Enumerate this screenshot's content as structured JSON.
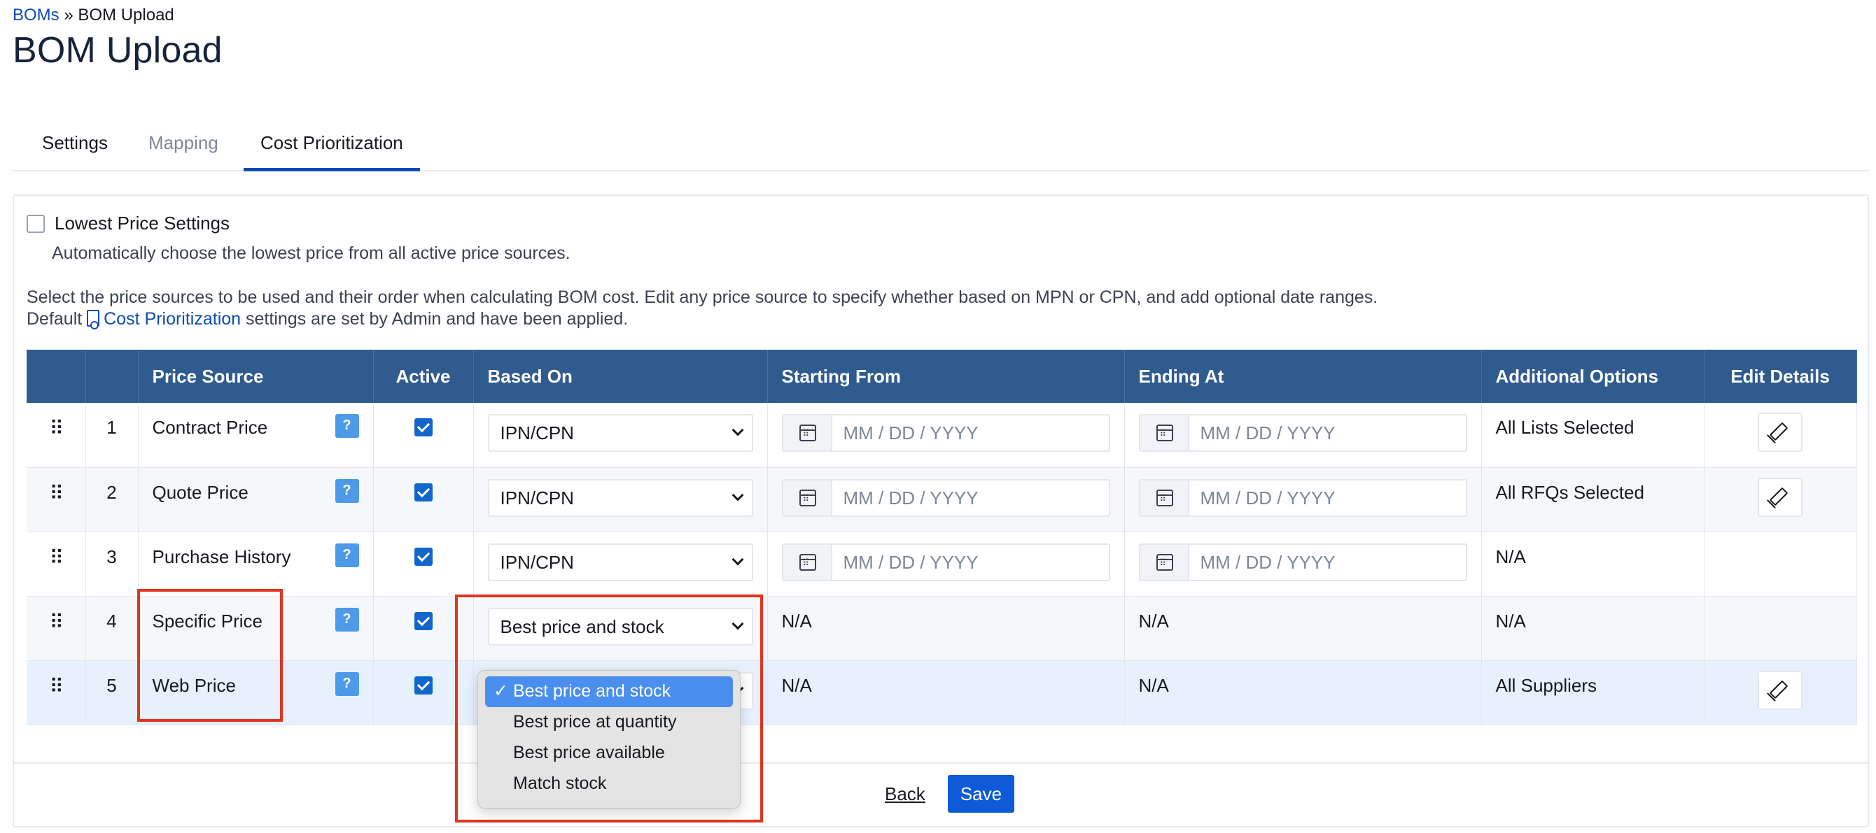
{
  "breadcrumb": {
    "parent": "BOMs",
    "separator": "»",
    "current": "BOM Upload"
  },
  "page_title": "BOM Upload",
  "tabs": [
    {
      "label": "Settings",
      "state": "default"
    },
    {
      "label": "Mapping",
      "state": "disabled"
    },
    {
      "label": "Cost Prioritization",
      "state": "active"
    }
  ],
  "lowest_price": {
    "label": "Lowest Price Settings",
    "checked": false,
    "help": "Automatically choose the lowest price from all active price sources."
  },
  "description": {
    "line1": "Select the price sources to be used and their order when calculating BOM cost. Edit any price source to specify whether based on MPN or CPN, and add optional date ranges.",
    "prefix": "Default",
    "link": "Cost Prioritization",
    "suffix": "settings are set by Admin and have been applied."
  },
  "table": {
    "headers": [
      "",
      "",
      "Price Source",
      "Active",
      "Based On",
      "Starting From",
      "Ending At",
      "Additional Options",
      "Edit Details"
    ],
    "date_placeholder": "MM / DD / YYYY",
    "help_badge": "?",
    "rows": [
      {
        "num": "1",
        "source": "Contract Price",
        "based_on": "IPN/CPN",
        "start": "date",
        "end": "date",
        "options": "All Lists Selected",
        "edit": true
      },
      {
        "num": "2",
        "source": "Quote Price",
        "based_on": "IPN/CPN",
        "start": "date",
        "end": "date",
        "options": "All RFQs Selected",
        "edit": true
      },
      {
        "num": "3",
        "source": "Purchase History",
        "based_on": "IPN/CPN",
        "start": "date",
        "end": "date",
        "options": "N/A",
        "edit": false
      },
      {
        "num": "4",
        "source": "Specific Price",
        "based_on": "Best price and stock",
        "start": "N/A",
        "end": "N/A",
        "options": "N/A",
        "edit": false
      },
      {
        "num": "5",
        "source": "Web Price",
        "based_on": "",
        "start": "N/A",
        "end": "N/A",
        "options": "All Suppliers",
        "edit": true
      }
    ]
  },
  "dropdown": {
    "checkmark": "✓",
    "options": [
      "Best price and stock",
      "Best price at quantity",
      "Best price available",
      "Match stock"
    ],
    "selected": "Best price and stock"
  },
  "footer": {
    "back": "Back",
    "save": "Save"
  },
  "colors": {
    "header": "#2f5b8f",
    "accent": "#0f4bb3",
    "highlight": "#e4331f",
    "checkbox": "#1166cc"
  }
}
